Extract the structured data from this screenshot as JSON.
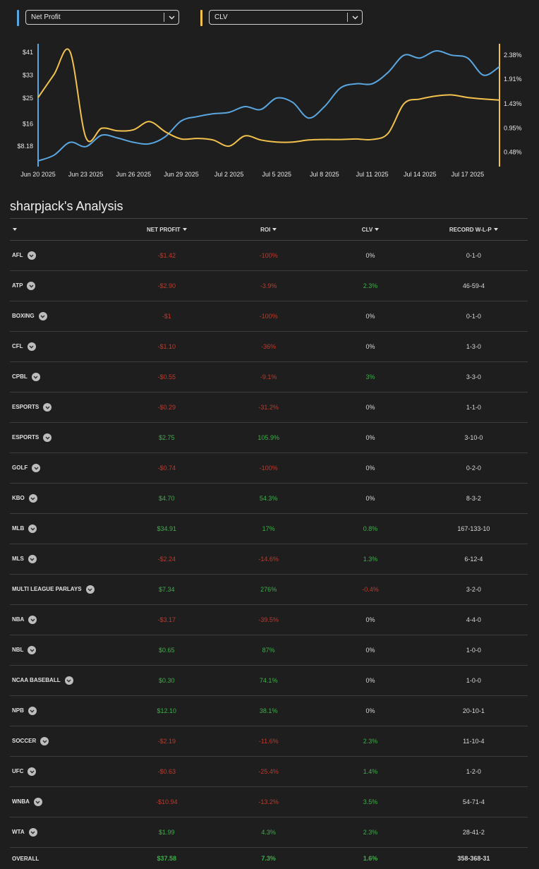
{
  "selectors": {
    "left": {
      "label": "Net Profit",
      "color": "#5aa6e0"
    },
    "right": {
      "label": "CLV",
      "color": "#f2c14e"
    }
  },
  "chart_data": {
    "type": "line",
    "x": [
      "Jun 20 2025",
      "Jun 21",
      "Jun 22",
      "Jun 23 2025",
      "Jun 24",
      "Jun 25",
      "Jun 26 2025",
      "Jun 27",
      "Jun 28",
      "Jun 29 2025",
      "Jun 30",
      "Jul 1",
      "Jul 2 2025",
      "Jul 3",
      "Jul 4",
      "Jul 5 2025",
      "Jul 6",
      "Jul 7",
      "Jul 8 2025",
      "Jul 9",
      "Jul 10",
      "Jul 11 2025",
      "Jul 12",
      "Jul 13",
      "Jul 14 2025",
      "Jul 15",
      "Jul 16",
      "Jul 17 2025",
      "Jul 18",
      "Jul 19"
    ],
    "xtick_labels": [
      "Jun 20 2025",
      "Jun 23 2025",
      "Jun 26 2025",
      "Jun 29 2025",
      "Jul 2 2025",
      "Jul 5 2025",
      "Jul 8 2025",
      "Jul 11 2025",
      "Jul 14 2025",
      "Jul 17 2025"
    ],
    "left_axis": {
      "ticks": [
        "$41",
        "$33",
        "$25",
        "$16",
        "$8.18"
      ],
      "tick_values": [
        41,
        33,
        25,
        16,
        8.18
      ],
      "range": [
        1,
        44
      ]
    },
    "right_axis": {
      "ticks": [
        "2.38%",
        "1.91%",
        "1.43%",
        "0.95%",
        "0.48%"
      ],
      "tick_values": [
        2.38,
        1.91,
        1.43,
        0.95,
        0.48
      ],
      "range": [
        0.2,
        2.6
      ]
    },
    "series": [
      {
        "name": "Net Profit",
        "axis": "left",
        "color": "#5aa6e0",
        "values": [
          3,
          5,
          9.5,
          8,
          12,
          11,
          9.5,
          9,
          11.5,
          17,
          18.5,
          19.5,
          20,
          22,
          21,
          25,
          23.5,
          18,
          22,
          28.5,
          30,
          30,
          34,
          40,
          39,
          41.5,
          40,
          39,
          33,
          36
        ]
      },
      {
        "name": "CLV",
        "axis": "right",
        "color": "#f2c14e",
        "values": [
          1.55,
          2.0,
          2.45,
          0.77,
          0.95,
          0.9,
          0.92,
          1.08,
          0.88,
          0.74,
          0.75,
          0.72,
          0.6,
          0.8,
          0.72,
          0.68,
          0.68,
          0.72,
          0.73,
          0.73,
          0.74,
          0.73,
          0.85,
          1.43,
          1.52,
          1.58,
          1.6,
          1.55,
          1.52,
          1.5
        ]
      }
    ],
    "grid": false,
    "legend": "none"
  },
  "analysis": {
    "title": "sharpjack's Analysis",
    "columns": [
      "",
      "NET PROFIT",
      "ROI",
      "CLV",
      "RECORD W-L-P"
    ],
    "rows": [
      {
        "name": "AFL",
        "profit": "-$1.42",
        "profit_sign": "neg",
        "roi": "-100%",
        "roi_sign": "neg",
        "clv": "0%",
        "clv_sign": "neu",
        "record": "0-1-0"
      },
      {
        "name": "ATP",
        "profit": "-$2.90",
        "profit_sign": "neg",
        "roi": "-3.9%",
        "roi_sign": "neg",
        "clv": "2.3%",
        "clv_sign": "pos",
        "record": "46-59-4"
      },
      {
        "name": "BOXING",
        "profit": "-$1",
        "profit_sign": "neg",
        "roi": "-100%",
        "roi_sign": "neg",
        "clv": "0%",
        "clv_sign": "neu",
        "record": "0-1-0"
      },
      {
        "name": "CFL",
        "profit": "-$1.10",
        "profit_sign": "neg",
        "roi": "-36%",
        "roi_sign": "neg",
        "clv": "0%",
        "clv_sign": "neu",
        "record": "1-3-0"
      },
      {
        "name": "CPBL",
        "profit": "-$0.55",
        "profit_sign": "neg",
        "roi": "-9.1%",
        "roi_sign": "neg",
        "clv": "3%",
        "clv_sign": "pos",
        "record": "3-3-0"
      },
      {
        "name": "ESPORTS",
        "profit": "-$0.29",
        "profit_sign": "neg",
        "roi": "-31.2%",
        "roi_sign": "neg",
        "clv": "0%",
        "clv_sign": "neu",
        "record": "1-1-0"
      },
      {
        "name": "ESPORTS",
        "profit": "$2.75",
        "profit_sign": "pos",
        "roi": "105.9%",
        "roi_sign": "pos",
        "clv": "0%",
        "clv_sign": "neu",
        "record": "3-10-0"
      },
      {
        "name": "GOLF",
        "profit": "-$0.74",
        "profit_sign": "neg",
        "roi": "-100%",
        "roi_sign": "neg",
        "clv": "0%",
        "clv_sign": "neu",
        "record": "0-2-0"
      },
      {
        "name": "KBO",
        "profit": "$4.70",
        "profit_sign": "pos",
        "roi": "54.3%",
        "roi_sign": "pos",
        "clv": "0%",
        "clv_sign": "neu",
        "record": "8-3-2"
      },
      {
        "name": "MLB",
        "profit": "$34.91",
        "profit_sign": "pos",
        "roi": "17%",
        "roi_sign": "pos",
        "clv": "0.8%",
        "clv_sign": "pos",
        "record": "167-133-10"
      },
      {
        "name": "MLS",
        "profit": "-$2.24",
        "profit_sign": "neg",
        "roi": "-14.6%",
        "roi_sign": "neg",
        "clv": "1.3%",
        "clv_sign": "pos",
        "record": "6-12-4"
      },
      {
        "name": "MULTI LEAGUE PARLAYS",
        "profit": "$7.34",
        "profit_sign": "pos",
        "roi": "276%",
        "roi_sign": "pos",
        "clv": "-0.4%",
        "clv_sign": "neg",
        "record": "3-2-0"
      },
      {
        "name": "NBA",
        "profit": "-$3.17",
        "profit_sign": "neg",
        "roi": "-39.5%",
        "roi_sign": "neg",
        "clv": "0%",
        "clv_sign": "neu",
        "record": "4-4-0"
      },
      {
        "name": "NBL",
        "profit": "$0.65",
        "profit_sign": "pos",
        "roi": "87%",
        "roi_sign": "pos",
        "clv": "0%",
        "clv_sign": "neu",
        "record": "1-0-0"
      },
      {
        "name": "NCAA BASEBALL",
        "profit": "$0.30",
        "profit_sign": "pos",
        "roi": "74.1%",
        "roi_sign": "pos",
        "clv": "0%",
        "clv_sign": "neu",
        "record": "1-0-0"
      },
      {
        "name": "NPB",
        "profit": "$12.10",
        "profit_sign": "pos",
        "roi": "38.1%",
        "roi_sign": "pos",
        "clv": "0%",
        "clv_sign": "neu",
        "record": "20-10-1"
      },
      {
        "name": "SOCCER",
        "profit": "-$2.19",
        "profit_sign": "neg",
        "roi": "-11.6%",
        "roi_sign": "neg",
        "clv": "2.3%",
        "clv_sign": "pos",
        "record": "11-10-4"
      },
      {
        "name": "UFC",
        "profit": "-$0.63",
        "profit_sign": "neg",
        "roi": "-25.4%",
        "roi_sign": "neg",
        "clv": "1.4%",
        "clv_sign": "pos",
        "record": "1-2-0"
      },
      {
        "name": "WNBA",
        "profit": "-$10.94",
        "profit_sign": "neg",
        "roi": "-13.2%",
        "roi_sign": "neg",
        "clv": "3.5%",
        "clv_sign": "pos",
        "record": "54-71-4"
      },
      {
        "name": "WTA",
        "profit": "$1.99",
        "profit_sign": "pos",
        "roi": "4.3%",
        "roi_sign": "pos",
        "clv": "2.3%",
        "clv_sign": "pos",
        "record": "28-41-2"
      }
    ],
    "overall": {
      "name": "OVERALL",
      "profit": "$37.58",
      "profit_sign": "pos",
      "roi": "7.3%",
      "roi_sign": "pos",
      "clv": "1.6%",
      "clv_sign": "pos",
      "record": "358-368-31"
    },
    "icons": {
      "expand": "chevron-down-circle-icon",
      "sort": "caret-down-icon",
      "select": "chevron-down-icon"
    }
  }
}
